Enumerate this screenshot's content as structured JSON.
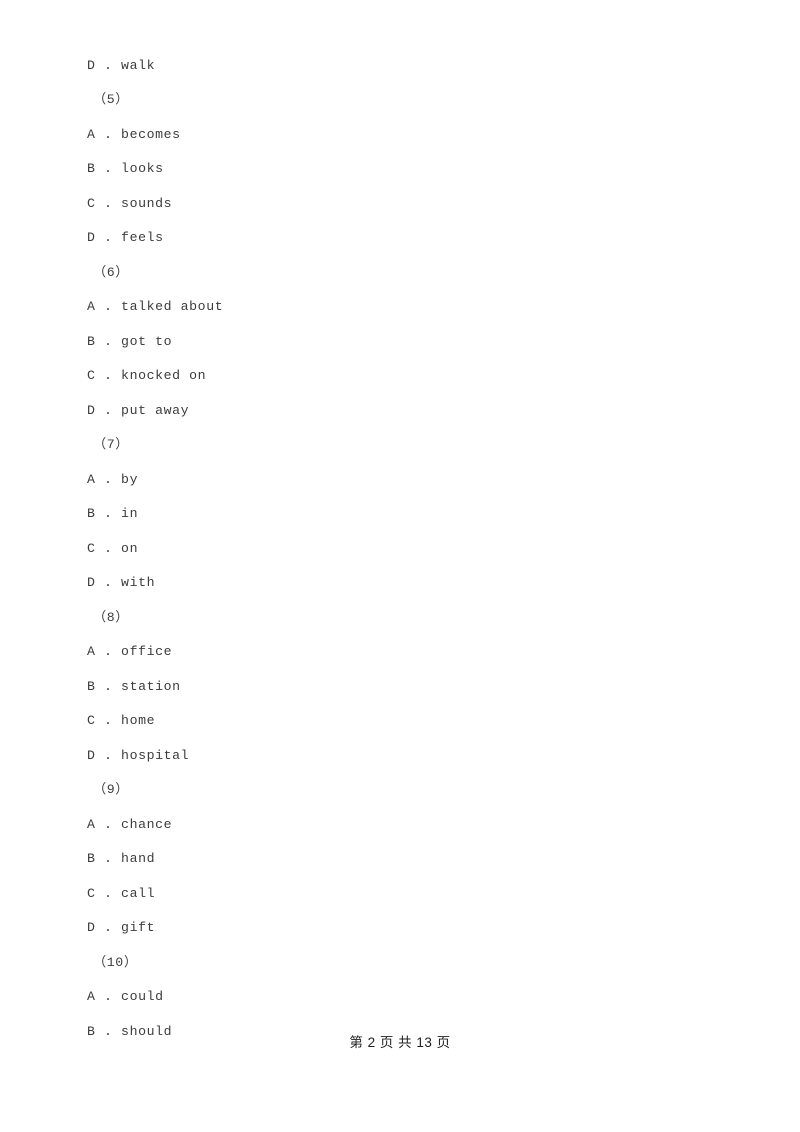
{
  "document": {
    "background_color": "#ffffff",
    "text_color": "#3c3c3c",
    "footer_color": "#1e1e1e"
  },
  "lines": [
    {
      "kind": "option",
      "text": "D . walk"
    },
    {
      "kind": "question",
      "text": "（5）"
    },
    {
      "kind": "option",
      "text": "A . becomes"
    },
    {
      "kind": "option",
      "text": "B . looks"
    },
    {
      "kind": "option",
      "text": "C . sounds"
    },
    {
      "kind": "option",
      "text": "D . feels"
    },
    {
      "kind": "question",
      "text": "（6）"
    },
    {
      "kind": "option",
      "text": "A . talked about"
    },
    {
      "kind": "option",
      "text": "B . got to"
    },
    {
      "kind": "option",
      "text": "C . knocked on"
    },
    {
      "kind": "option",
      "text": "D . put away"
    },
    {
      "kind": "question",
      "text": "（7）"
    },
    {
      "kind": "option",
      "text": "A . by"
    },
    {
      "kind": "option",
      "text": "B . in"
    },
    {
      "kind": "option",
      "text": "C . on"
    },
    {
      "kind": "option",
      "text": "D . with"
    },
    {
      "kind": "question",
      "text": "（8）"
    },
    {
      "kind": "option",
      "text": "A . office"
    },
    {
      "kind": "option",
      "text": "B . station"
    },
    {
      "kind": "option",
      "text": "C . home"
    },
    {
      "kind": "option",
      "text": "D . hospital"
    },
    {
      "kind": "question",
      "text": "（9）"
    },
    {
      "kind": "option",
      "text": "A . chance"
    },
    {
      "kind": "option",
      "text": "B . hand"
    },
    {
      "kind": "option",
      "text": "C . call"
    },
    {
      "kind": "option",
      "text": "D . gift"
    },
    {
      "kind": "question",
      "text": "（10）"
    },
    {
      "kind": "option",
      "text": "A . could"
    },
    {
      "kind": "option",
      "text": "B . should"
    }
  ],
  "footer": {
    "text": "第 2 页 共 13 页",
    "page_number": 2,
    "total_pages": 13
  }
}
